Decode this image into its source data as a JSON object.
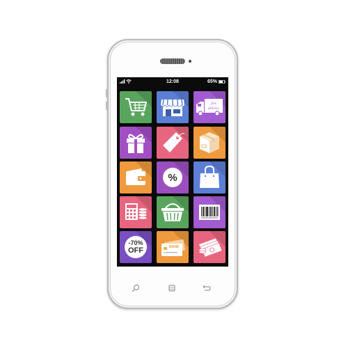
{
  "status_bar": {
    "time": "12:08",
    "battery_percent": "65%",
    "signal_icon": "signal-bars-icon",
    "wifi_icon": "wifi-icon",
    "battery_icon": "battery-icon"
  },
  "apps": [
    {
      "name": "shopping-cart",
      "icon": "shopping-cart-icon",
      "color": "#5aa55e"
    },
    {
      "name": "storefront",
      "icon": "store-icon",
      "color": "#5c7fd6"
    },
    {
      "name": "free-delivery",
      "icon": "delivery-truck-icon",
      "color": "#a25bd0",
      "text": "free delivery"
    },
    {
      "name": "gift",
      "icon": "gift-box-icon",
      "color": "#a24fc4"
    },
    {
      "name": "price-tag",
      "icon": "price-tag-icon",
      "color": "#e8657f"
    },
    {
      "name": "package",
      "icon": "package-box-icon",
      "color": "#ef9a3d"
    },
    {
      "name": "wallet",
      "icon": "wallet-icon",
      "color": "#ef9a3d"
    },
    {
      "name": "discount",
      "icon": "percent-icon",
      "color": "#9b4fbf",
      "text": "%"
    },
    {
      "name": "shopping-bag",
      "icon": "shopping-bag-icon",
      "color": "#5c7fd6"
    },
    {
      "name": "calculator",
      "icon": "calculator-icon",
      "color": "#e8657f"
    },
    {
      "name": "basket",
      "icon": "basket-icon",
      "color": "#5aa55e"
    },
    {
      "name": "barcode",
      "icon": "barcode-icon",
      "color": "#a25bd0"
    },
    {
      "name": "sale-badge",
      "icon": "sale-badge-icon",
      "color": "#7a4fc4",
      "text_top": "-70%",
      "text_bottom": "OFF"
    },
    {
      "name": "credit-card",
      "icon": "credit-card-icon",
      "color": "#ef9a3d",
      "text": "BANK"
    },
    {
      "name": "money",
      "icon": "money-stack-icon",
      "color": "#e8657f"
    }
  ],
  "nav_keys": [
    {
      "name": "search-key",
      "icon": "search-icon"
    },
    {
      "name": "home-key",
      "icon": "home-square-icon"
    },
    {
      "name": "back-key",
      "icon": "back-arrow-icon"
    }
  ]
}
